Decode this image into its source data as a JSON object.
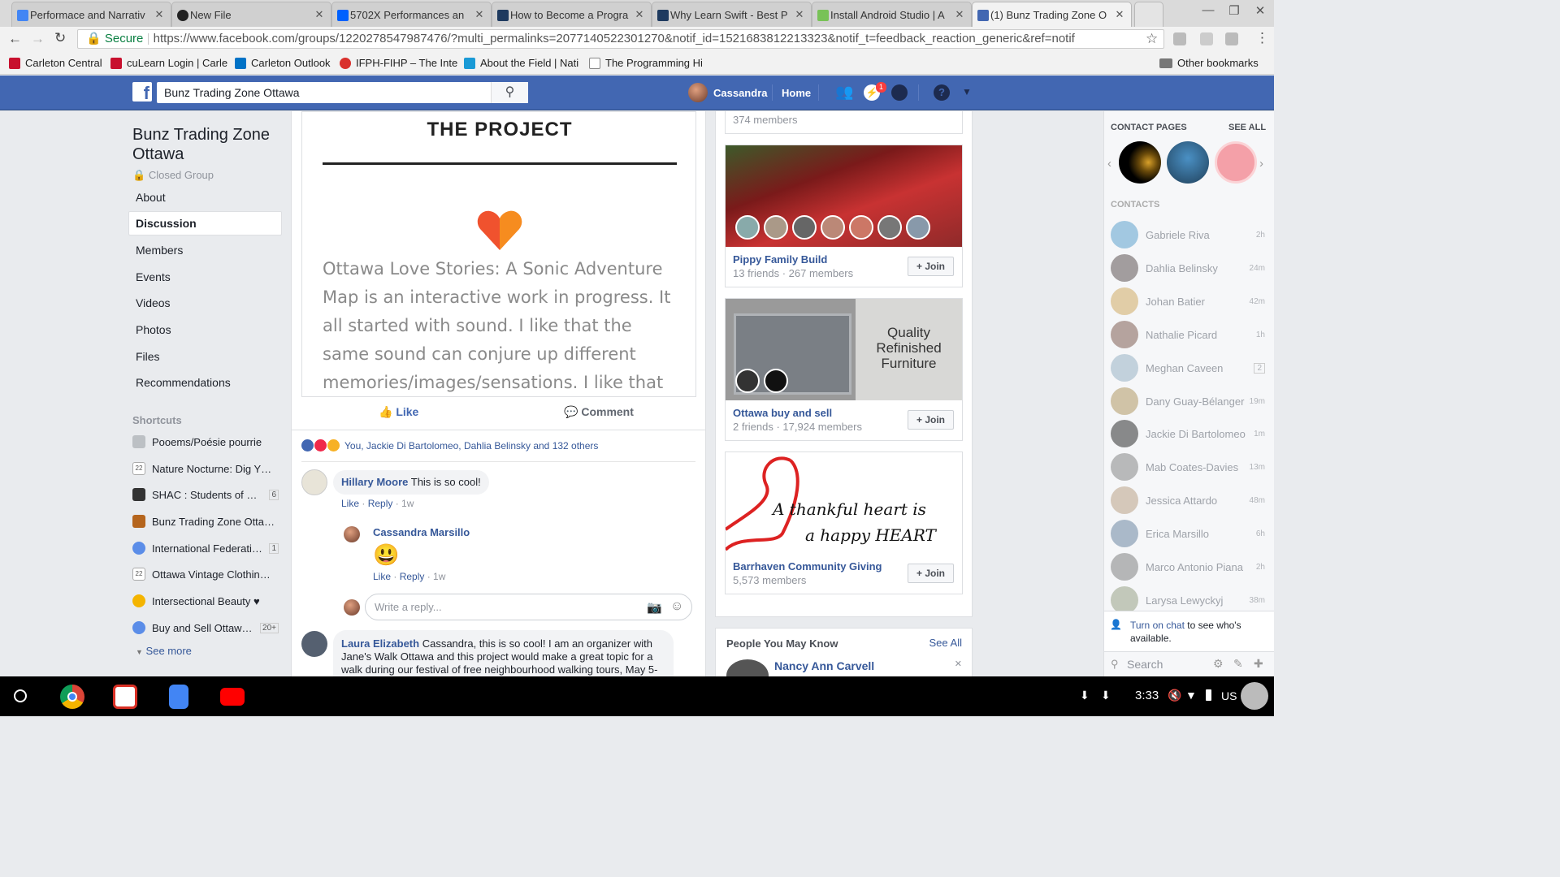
{
  "browser": {
    "tabs": [
      {
        "title": "Performace and Narrativ",
        "icon": "docs-icon",
        "color": "#4285f4"
      },
      {
        "title": "New File",
        "icon": "github-icon",
        "color": "#222222"
      },
      {
        "title": "5702X Performances an",
        "icon": "dropbox-icon",
        "color": "#0061fe"
      },
      {
        "title": "How to Become a Progra",
        "icon": "code-icon",
        "color": "#1e3a5f"
      },
      {
        "title": "Why Learn Swift - Best P",
        "icon": "code-icon",
        "color": "#1e3a5f"
      },
      {
        "title": "Install Android Studio | A",
        "icon": "android-icon",
        "color": "#78c257"
      },
      {
        "title": "(1) Bunz Trading Zone O",
        "icon": "facebook-icon",
        "color": "#4267b2"
      }
    ],
    "secure_label": "Secure",
    "url": "https://www.facebook.com/groups/1220278547987476/?multi_permalinks=2077140522301270&notif_id=1521683812213323&notif_t=feedback_reaction_generic&ref=notif",
    "bookmarks": [
      {
        "label": "Carleton Central",
        "color": "#c8102e"
      },
      {
        "label": "cuLearn Login | Carle",
        "color": "#c8102e"
      },
      {
        "label": "Carleton Outlook",
        "color": "#0072c6"
      },
      {
        "label": "IFPH-FIHP – The Inte",
        "color": "#d9302c"
      },
      {
        "label": "About the Field | Nati",
        "color": "#1a9ad6"
      },
      {
        "label": "The Programming Hi",
        "color": "#888888"
      }
    ],
    "other_bookmarks": "Other bookmarks"
  },
  "fb_header": {
    "search_value": "Bunz Trading Zone Ottawa",
    "user_name": "Cassandra",
    "home_label": "Home",
    "messages_badge": "1"
  },
  "group": {
    "name": "Bunz Trading Zone Ottawa",
    "privacy": "Closed Group",
    "nav": [
      "About",
      "Discussion",
      "Members",
      "Events",
      "Videos",
      "Photos",
      "Files",
      "Recommendations"
    ],
    "active_nav": "Discussion",
    "shortcuts_title": "Shortcuts",
    "shortcuts": [
      {
        "name": "Pooems/Poésie pourrie",
        "count": "",
        "icon": "image-icon",
        "color": "#bcc0c4"
      },
      {
        "name": "Nature Nocturne: Dig Y…",
        "count": "",
        "icon": "calendar-icon",
        "color": "#e0e0e0"
      },
      {
        "name": "SHAC : Students of …",
        "count": "6",
        "icon": "graduation-cap-icon",
        "color": "#333333"
      },
      {
        "name": "Bunz Trading Zone Otta…",
        "count": "",
        "icon": "guitar-icon",
        "color": "#b5651d"
      },
      {
        "name": "International Federati…",
        "count": "1",
        "icon": "group-icon",
        "color": "#5b8de8"
      },
      {
        "name": "Ottawa Vintage Clothin…",
        "count": "",
        "icon": "calendar-icon",
        "color": "#e0e0e0"
      },
      {
        "name": "Intersectional Beauty ♥",
        "count": "",
        "icon": "flower-icon",
        "color": "#f4b400"
      },
      {
        "name": "Buy and Sell Ottaw…",
        "count": "20+",
        "icon": "group-icon",
        "color": "#5b8de8"
      }
    ],
    "see_more": "See more"
  },
  "post": {
    "image_heading": "THE PROJECT",
    "image_text": "Ottawa Love Stories: A Sonic Adventure Map is an interactive work in progress. It all started with sound. I like that the same sound can conjure up different memories/images/sensations. I like that",
    "like_label": "Like",
    "comment_label": "Comment",
    "reactions_text": "You, Jackie Di Bartolomeo, Dahlia Belinsky and 132 others",
    "comments": [
      {
        "author": "Hillary Moore",
        "text": "This is so cool!",
        "like": "Like",
        "reply": "Reply",
        "time": "1w"
      },
      {
        "author": "Cassandra Marsillo",
        "text": "😃",
        "like": "Like",
        "reply": "Reply",
        "time": "1w"
      },
      {
        "author": "Laura Elizabeth",
        "text": "Cassandra, this is so cool! I am an organizer with Jane's Walk Ottawa and this project would make a great topic for a walk during our festival of free neighbourhood walking tours, May 5-"
      }
    ],
    "reply_placeholder": "Write a reply..."
  },
  "suggested_groups": {
    "top_members": "374 members",
    "groups": [
      {
        "name": "Pippy Family Build",
        "meta": "13 friends · 267 members",
        "join": "Join"
      },
      {
        "name": "Ottawa buy and sell",
        "meta": "2 friends · 17,924 members",
        "join": "Join",
        "banner_text": "Quality Refinished Furniture"
      },
      {
        "name": "Barrhaven Community Giving",
        "meta": "5,573 members",
        "join": "Join",
        "banner_text_1": "A thankful heart is",
        "banner_text_2": "a happy HEART"
      }
    ]
  },
  "people_you_may_know": {
    "title": "People You May Know",
    "see_all": "See All",
    "person": "Nancy Ann Carvell"
  },
  "chat": {
    "contact_pages_title": "CONTACT PAGES",
    "see_all": "SEE ALL",
    "contacts_title": "CONTACTS",
    "contacts": [
      {
        "name": "Gabriele Riva",
        "time": "2h"
      },
      {
        "name": "Dahlia Belinsky",
        "time": "24m"
      },
      {
        "name": "Johan Batier",
        "time": "42m"
      },
      {
        "name": "Nathalie Picard",
        "time": "1h"
      },
      {
        "name": "Meghan Caveen",
        "time": "2"
      },
      {
        "name": "Dany Guay-Bélanger",
        "time": "19m"
      },
      {
        "name": "Jackie Di Bartolomeo",
        "time": "1m"
      },
      {
        "name": "Mab Coates-Davies",
        "time": "13m"
      },
      {
        "name": "Jessica Attardo",
        "time": "48m"
      },
      {
        "name": "Erica Marsillo",
        "time": "6h"
      },
      {
        "name": "Marco Antonio Piana",
        "time": "2h"
      },
      {
        "name": "Larysa Lewyckyj",
        "time": "38m"
      }
    ],
    "turn_on_chat": "Turn on chat",
    "turn_on_rest": " to see who's available.",
    "search_placeholder": "Search"
  },
  "taskbar": {
    "time": "3:33",
    "locale": "US"
  }
}
